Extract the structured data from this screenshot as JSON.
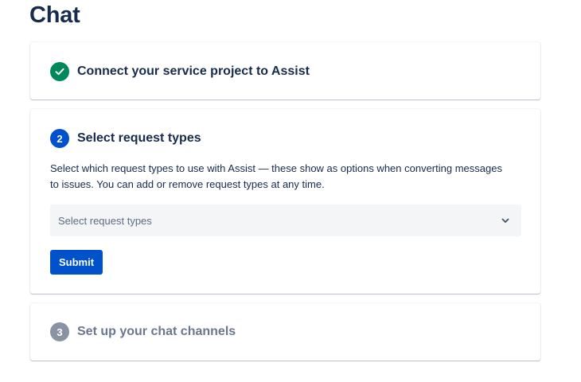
{
  "page": {
    "title": "Chat"
  },
  "steps": [
    {
      "number": "",
      "status": "complete",
      "title": "Connect your service project to Assist"
    },
    {
      "number": "2",
      "status": "active",
      "title": "Select request types",
      "description": "Select which request types to use with Assist — these show as options when converting messages to issues. You can add or remove request types at any time.",
      "select": {
        "placeholder": "Select request types"
      },
      "submit_label": "Submit"
    },
    {
      "number": "3",
      "status": "pending",
      "title": "Set up your chat channels"
    }
  ],
  "colors": {
    "complete": "#00875a",
    "active": "#0052cc",
    "pending": "#8993a4",
    "text": "#172b4d"
  },
  "icons": {
    "complete": "checkmark-icon",
    "select": "chevron-down-icon"
  }
}
